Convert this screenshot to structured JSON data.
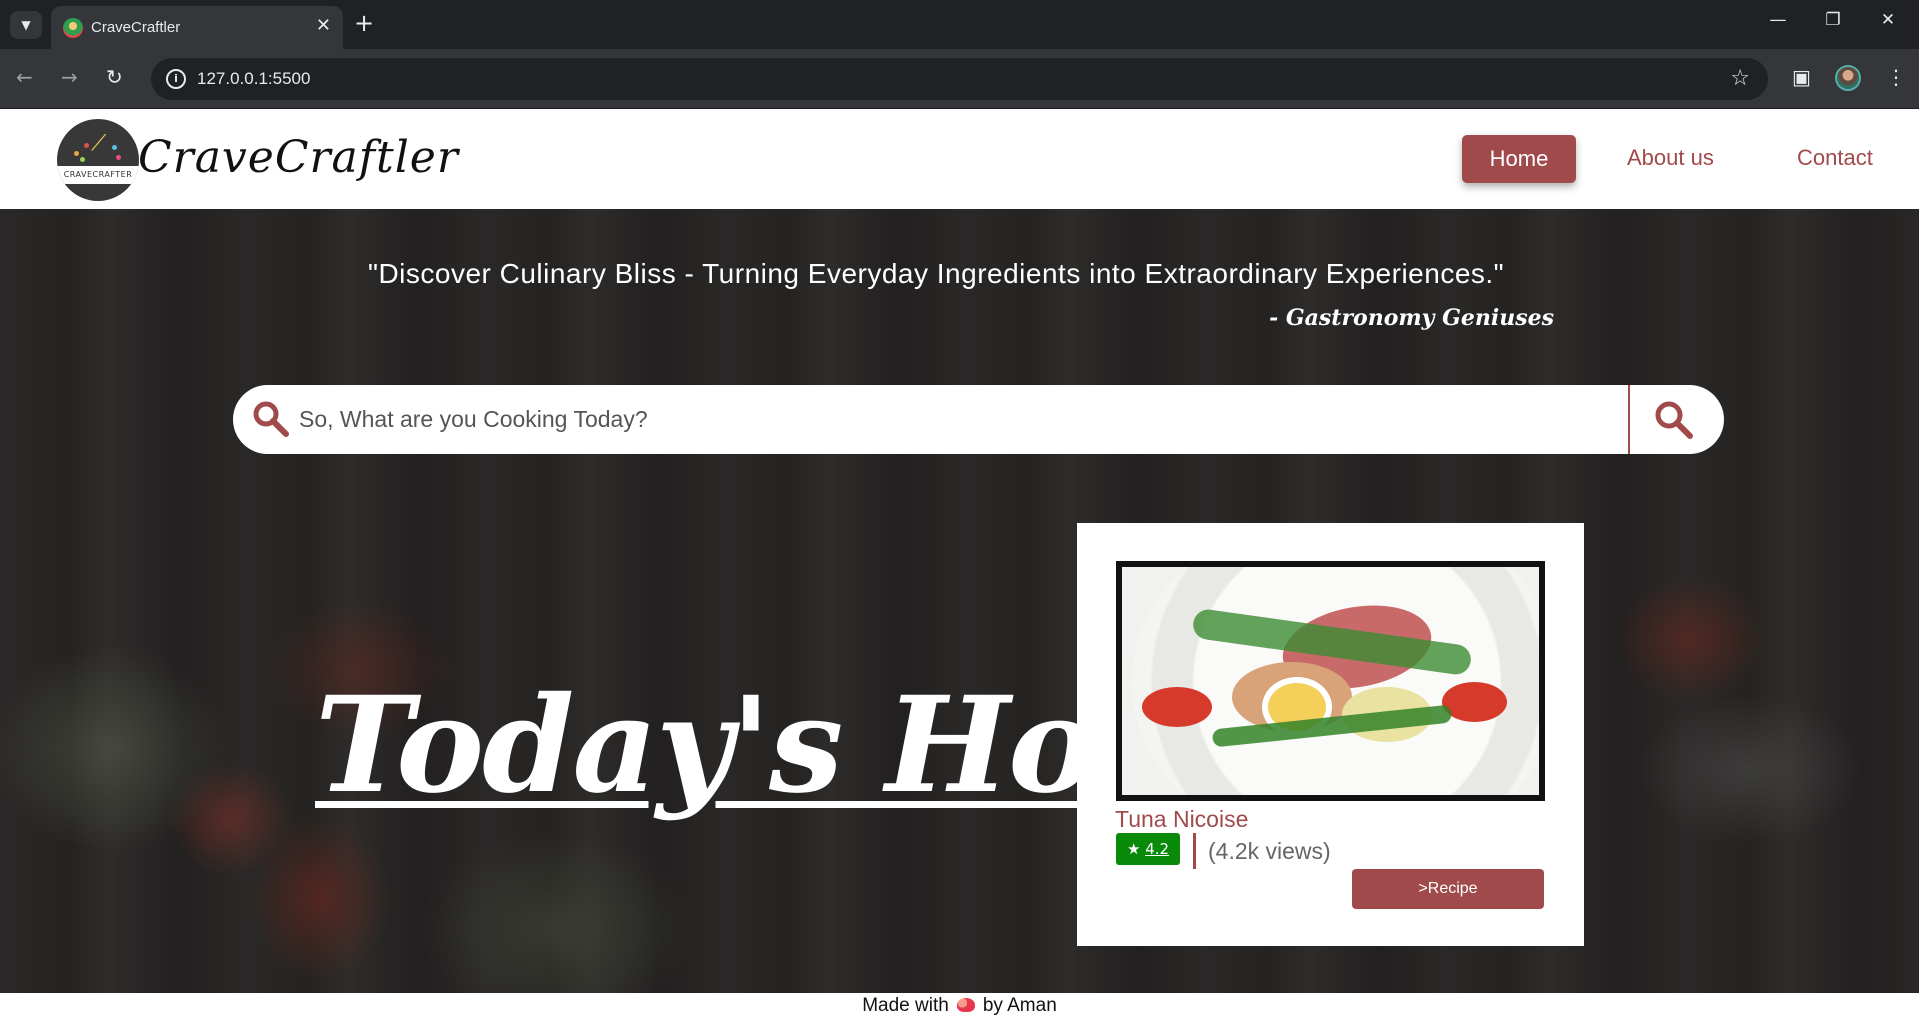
{
  "browser": {
    "tab_title": "CraveCraftler",
    "tab_close": "✕",
    "new_tab": "+",
    "url": "127.0.0.1:5500",
    "minimize": "—",
    "restore": "❐",
    "close": "✕"
  },
  "header": {
    "brand": "CraveCraftler",
    "logo_text": "CRAVECRAFTER",
    "nav": [
      {
        "label": "Home"
      },
      {
        "label": "About us"
      },
      {
        "label": "Contact"
      }
    ]
  },
  "hero": {
    "quote": "\"Discover Culinary Bliss - Turning Everyday Ingredients into Extraordinary Experiences.\"",
    "quote_author": "- Gastronomy Geniuses",
    "search_placeholder": "So, What are you Cooking Today?",
    "hot_title": "Today's Hot"
  },
  "card": {
    "recipe_name": "Tuna Nicoise",
    "rating_star": "★",
    "rating": "4.2",
    "views": "(4.2k views)",
    "button_label": ">Recipe"
  },
  "footer": {
    "made_with": "Made with",
    "by": "by Aman"
  },
  "colors": {
    "accent": "#a14a4c",
    "rating_green": "#0a8a0a",
    "hero_background": "#262423"
  },
  "icons": [
    "chevron-down-icon",
    "favicon-icon",
    "close-icon",
    "plus-icon",
    "back-icon",
    "forward-icon",
    "reload-icon",
    "site-info-icon",
    "star-icon",
    "sidepanel-icon",
    "profile-icon",
    "menu-icon",
    "search-icon",
    "heart-icon"
  ]
}
